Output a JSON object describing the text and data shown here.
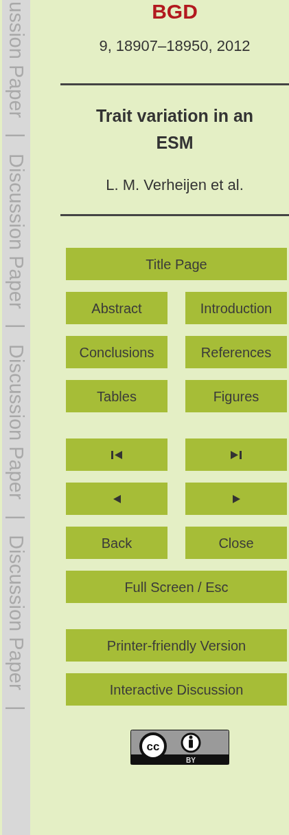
{
  "side_margin": {
    "labels": [
      "ussion Paper",
      "|",
      "Discussion Paper",
      "|",
      "Discussion Paper",
      "|",
      "Discussion Paper",
      "|"
    ]
  },
  "header": {
    "journal": "BGD",
    "citation": "9, 18907–18950, 2012",
    "title": "Trait variation in an ESM",
    "authors": "L. M. Verheijen et al."
  },
  "nav_groups": [
    [
      [
        {
          "kind": "text",
          "label": "Title Page"
        }
      ],
      [
        {
          "kind": "text",
          "label": "Abstract"
        },
        {
          "kind": "text",
          "label": "Introduction"
        }
      ],
      [
        {
          "kind": "text",
          "label": "Conclusions"
        },
        {
          "kind": "text",
          "label": "References"
        }
      ],
      [
        {
          "kind": "text",
          "label": "Tables"
        },
        {
          "kind": "text",
          "label": "Figures"
        }
      ]
    ],
    [
      [
        {
          "kind": "first"
        },
        {
          "kind": "last"
        }
      ],
      [
        {
          "kind": "prev"
        },
        {
          "kind": "next"
        }
      ],
      [
        {
          "kind": "text",
          "label": "Back"
        },
        {
          "kind": "text",
          "label": "Close"
        }
      ],
      [
        {
          "kind": "text",
          "label": "Full Screen / Esc"
        }
      ]
    ],
    [
      [
        {
          "kind": "text",
          "label": "Printer-friendly Version"
        }
      ],
      [
        {
          "kind": "text",
          "label": "Interactive Discussion"
        }
      ]
    ]
  ],
  "license": {
    "kind": "cc-by",
    "symbol": "cc",
    "label": "BY"
  }
}
